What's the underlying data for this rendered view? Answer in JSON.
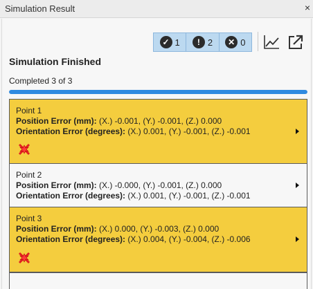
{
  "window": {
    "title": "Simulation Result",
    "close_glyph": "×"
  },
  "summary_badges": [
    {
      "icon": "check-circle-icon",
      "glyph": "✓",
      "count": "1"
    },
    {
      "icon": "exclamation-circle-icon",
      "glyph": "!",
      "count": "2"
    },
    {
      "icon": "x-circle-icon",
      "glyph": "✕",
      "count": "0"
    }
  ],
  "toolbar": {
    "chart_icon": "line-chart-icon",
    "export_icon": "external-link-icon"
  },
  "status": {
    "heading": "Simulation Finished",
    "progress_text": "Completed 3 of 3",
    "progress_fraction": 1.0
  },
  "points": [
    {
      "name": "Point 1",
      "position_label": "Position Error (mm):",
      "position_value": " (X.) -0.001, (Y.) -0.001, (Z.) 0.000",
      "orientation_label": "Orientation Error (degrees):",
      "orientation_value": " (X.) 0.001, (Y.) -0.001, (Z.) -0.001",
      "status": "collision",
      "highlight_color": "#f4cd3e"
    },
    {
      "name": "Point 2",
      "position_label": "Position Error (mm):",
      "position_value": " (X.) -0.000, (Y.) -0.001, (Z.) 0.000",
      "orientation_label": "Orientation Error (degrees):",
      "orientation_value": " (X.) 0.001, (Y.) -0.001, (Z.) -0.001",
      "status": "ok"
    },
    {
      "name": "Point 3",
      "position_label": "Position Error (mm):",
      "position_value": " (X.) 0.000, (Y.) -0.003, (Z.) 0.000",
      "orientation_label": "Orientation Error (degrees):",
      "orientation_value": " (X.) 0.004, (Y.) -0.004, (Z.) -0.006",
      "status": "collision",
      "highlight_color": "#f4cd3e"
    }
  ],
  "colors": {
    "progress": "#2f8ae0",
    "badge_bg": "#bcd9f0",
    "collision_icon": "#e02020"
  }
}
